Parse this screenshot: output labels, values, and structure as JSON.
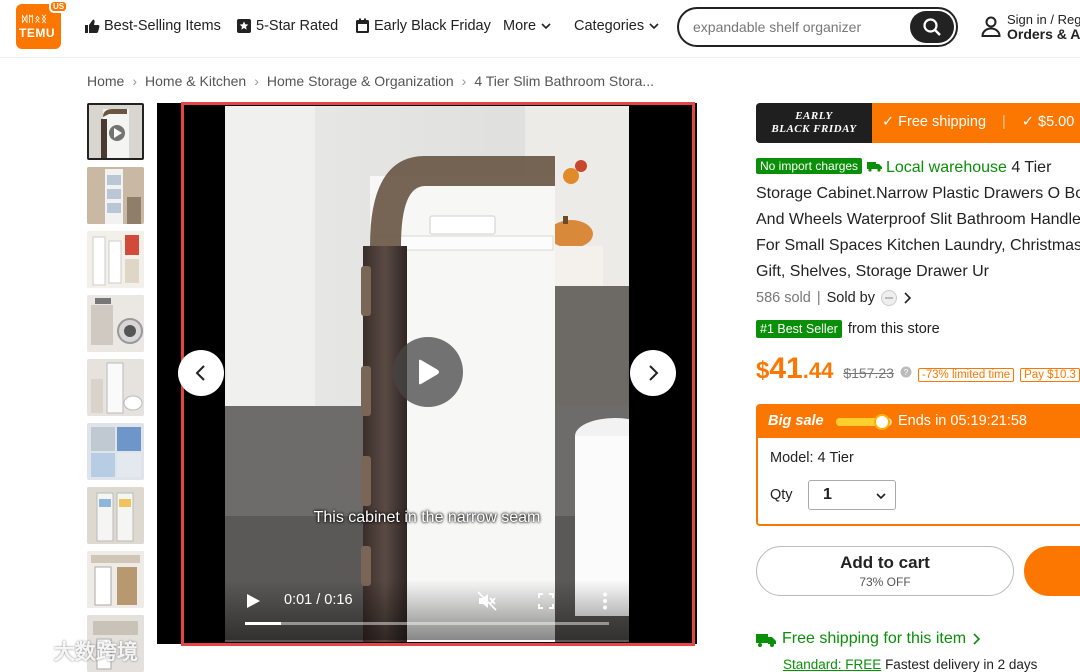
{
  "header": {
    "logo": {
      "glyphs": "ᛞᛖᛟᛝ",
      "word": "TEMU",
      "region": "US"
    },
    "nav": {
      "best_selling": "Best-Selling Items",
      "five_star": "5-Star Rated",
      "early_bf": "Early Black Friday",
      "more": "More",
      "categories": "Categories"
    },
    "search": {
      "value": "expandable shelf organizer"
    },
    "account": {
      "line1": "Sign in / Reg",
      "line2": "Orders & A"
    }
  },
  "breadcrumb": [
    "Home",
    "Home & Kitchen",
    "Home Storage & Organization",
    "4 Tier Slim Bathroom Stora..."
  ],
  "video": {
    "caption": "This cabinet in the narrow seam",
    "time": "0:01 / 0:16",
    "progress": 0.1
  },
  "promo": {
    "event_line1": "EARLY",
    "event_line2": "BLACK FRIDAY",
    "free_shipping": "✓ Free shipping",
    "credit": "✓ $5.00"
  },
  "product": {
    "no_import": "No import charges",
    "local_warehouse": "Local warehouse",
    "title": "4 Tier Storage Cabinet.Narrow Plastic Drawers O Box And Wheels Waterproof Slit Bathroom Handle For Small Spaces Kitchen Laundry, Christmas Gift, Shelves, Storage Drawer Ur",
    "sold": "586 sold",
    "sold_by": "Sold by",
    "best_seller": "#1 Best Seller",
    "best_seller_suffix": "from this store",
    "price_currency": "$",
    "price_int": "41",
    "price_dec": ".44",
    "price_orig": "$157.23",
    "discount_tag": "-73% limited time",
    "pay_tag": "Pay $10.3"
  },
  "sale": {
    "label": "Big sale",
    "ends": "Ends in 05:19:21:58",
    "model": "Model: 4 Tier",
    "qty_label": "Qty",
    "qty_value": "1"
  },
  "cart": {
    "add_label": "Add to cart",
    "add_sub": "73% OFF"
  },
  "shipping": {
    "line": "Free shipping for this item",
    "std_prefix": "Standard: FREE",
    "std_suffix": "Fastest delivery in 2 days"
  },
  "watermark": "大数跨境",
  "colors": {
    "brand": "#fb7701",
    "green": "#0a8f08",
    "frame": "#e64545"
  }
}
